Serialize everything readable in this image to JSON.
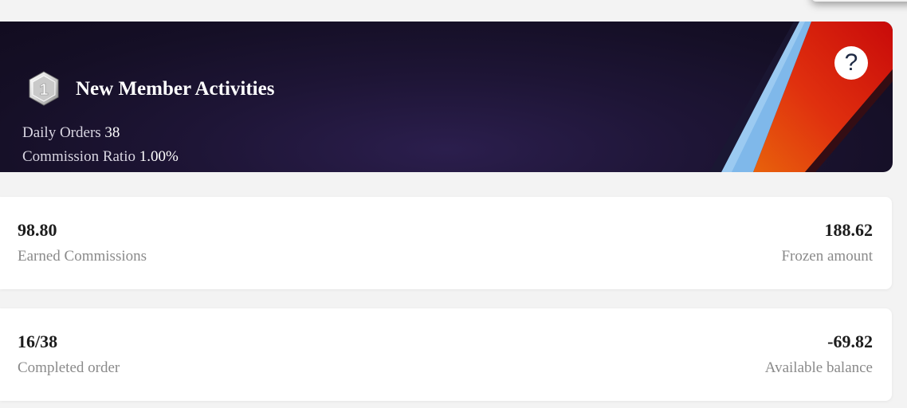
{
  "banner": {
    "level_badge": "1",
    "title": "New Member Activities",
    "daily_orders_label": "Daily Orders",
    "daily_orders_value": "38",
    "commission_ratio_label": "Commission Ratio",
    "commission_ratio_value": "1.00%",
    "help_icon": "question-mark-icon",
    "help_glyph": "?"
  },
  "stats": {
    "earned_commissions": {
      "value": "98.80",
      "label": "Earned Commissions"
    },
    "frozen_amount": {
      "value": "188.62",
      "label": "Frozen amount"
    },
    "completed_order": {
      "value": "16/38",
      "label": "Completed order"
    },
    "available_balance": {
      "value": "-69.82",
      "label": "Available balance"
    }
  },
  "colors": {
    "banner_bg": "#1e1536",
    "stripe_blue": "#7fb8ea",
    "stripe_orange": "#e5520f",
    "stripe_red": "#d40e0e",
    "page_bg": "#f3f3f3"
  }
}
